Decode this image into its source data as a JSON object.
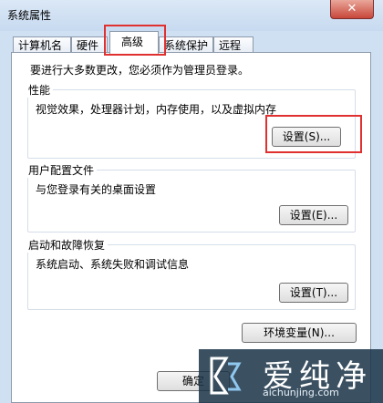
{
  "window": {
    "title": "系统属性",
    "close_glyph": "✕"
  },
  "tabs": [
    {
      "label": "计算机名",
      "active": false
    },
    {
      "label": "硬件",
      "active": false
    },
    {
      "label": "高级",
      "active": true
    },
    {
      "label": "系统保护",
      "active": false
    },
    {
      "label": "远程",
      "active": false
    }
  ],
  "main": {
    "intro": "要进行大多数更改，您必须作为管理员登录。",
    "performance": {
      "title": "性能",
      "desc": "视觉效果，处理器计划，内存使用，以及虚拟内存",
      "button": "设置(S)..."
    },
    "user_profiles": {
      "title": "用户配置文件",
      "desc": "与您登录有关的桌面设置",
      "button": "设置(E)..."
    },
    "startup_recovery": {
      "title": "启动和故障恢复",
      "desc": "系统启动、系统失败和调试信息",
      "button": "设置(T)..."
    },
    "env_button": "环境变量(N)..."
  },
  "footer": {
    "ok_label": "确定"
  },
  "watermark": {
    "text": "爱纯净",
    "url": "aichunjing.com"
  },
  "colors": {
    "highlight": "#e03030",
    "window_bg": "#cfe0f3",
    "watermark_bg": "#193246"
  }
}
